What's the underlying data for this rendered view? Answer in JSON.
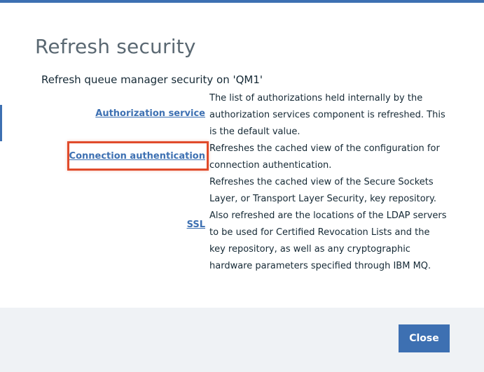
{
  "dialog": {
    "title": "Refresh security",
    "subtitle": "Refresh queue manager security on 'QM1'"
  },
  "options": [
    {
      "link": "Authorization service",
      "description": "The list of authorizations held internally by the authorization services component is refreshed. This is the default value."
    },
    {
      "link": "Connection authentication",
      "description": "Refreshes the cached view of the configuration for connection authentication.",
      "highlighted": true
    },
    {
      "link": "SSL",
      "description": "Refreshes the cached view of the Secure Sockets Layer, or Transport Layer Security, key repository. Also refreshed are the locations of the LDAP servers to be used for Certified Revocation Lists and the key repository, as well as any cryptographic hardware parameters specified through IBM MQ."
    }
  ],
  "footer": {
    "close_label": "Close"
  },
  "colors": {
    "accent": "#3d70b2",
    "highlight": "#e04b2b",
    "footer_bg": "#eff2f5"
  }
}
